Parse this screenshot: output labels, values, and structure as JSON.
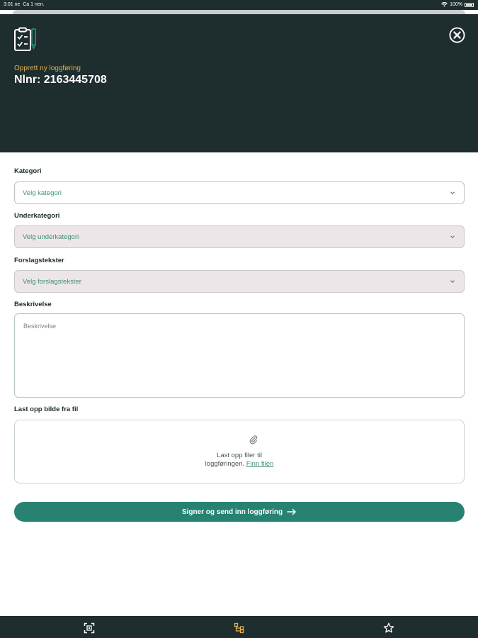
{
  "status_bar": {
    "time": "3:01 ne",
    "date": "Ca 1 nen.",
    "battery": "100%"
  },
  "header": {
    "subtitle": "Opprett ny loggføring",
    "title": "Nlnr: 2163445708",
    "accent_color": "#e8b14a",
    "background_color": "#1e2d2e"
  },
  "form": {
    "kategori": {
      "label": "Kategori",
      "placeholder": "Velg kategori"
    },
    "underkategori": {
      "label": "Underkategori",
      "placeholder": "Velg underkategori"
    },
    "forslagstekster": {
      "label": "Forslagstekster",
      "placeholder": "Velg forslagstekster"
    },
    "beskrivelse": {
      "label": "Beskrivelse",
      "placeholder": "Beskrivelse"
    },
    "upload": {
      "label": "Last opp bilde fra fil",
      "line1": "Last opp filer til",
      "line2": "loggføringen.",
      "link": "Finn filen"
    }
  },
  "submit": {
    "label": "Signer og send inn loggføring",
    "color": "#278271"
  },
  "tabbar": {
    "items": [
      {
        "icon": "scan-icon"
      },
      {
        "icon": "log-tree-icon",
        "active": true
      },
      {
        "icon": "star-icon"
      }
    ]
  }
}
